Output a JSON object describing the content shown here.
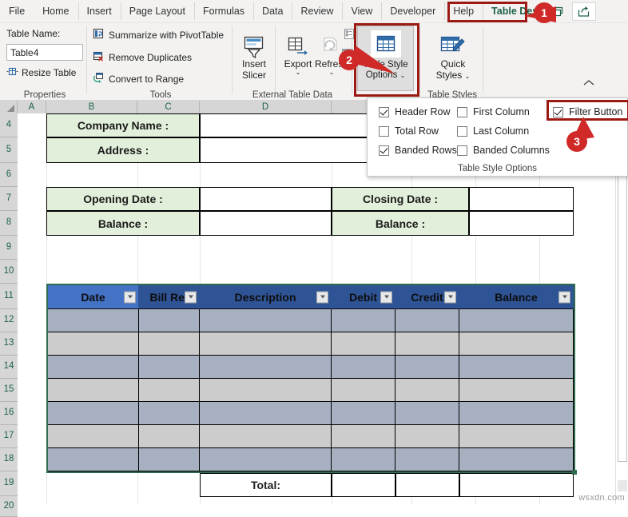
{
  "ribbon": {
    "tabs": [
      {
        "label": "File",
        "active": false
      },
      {
        "label": "Home",
        "active": false
      },
      {
        "label": "Insert",
        "active": false
      },
      {
        "label": "Page Layout",
        "active": false
      },
      {
        "label": "Formulas",
        "active": false
      },
      {
        "label": "Data",
        "active": false
      },
      {
        "label": "Review",
        "active": false
      },
      {
        "label": "View",
        "active": false
      },
      {
        "label": "Developer",
        "active": false
      },
      {
        "label": "Help",
        "active": false
      },
      {
        "label": "Table Design",
        "active": true
      }
    ],
    "share_icon": "share-icon",
    "restore_icon": "restore-window-icon",
    "collapse_icon": "chevron-up-icon",
    "groups": {
      "properties": {
        "title": "Properties",
        "table_name_label": "Table Name:",
        "table_name_value": "Table4",
        "resize_table": "Resize Table"
      },
      "tools": {
        "title": "Tools",
        "items": [
          "Summarize with PivotTable",
          "Remove Duplicates",
          "Convert to Range"
        ]
      },
      "external_table_data": {
        "title": "External Table Data",
        "insert_slicer": "Insert\nSlicer",
        "insert_slicer_line1": "Insert",
        "insert_slicer_line2": "Slicer",
        "export": "Export",
        "refresh": "Refresh"
      },
      "table_style_options": {
        "button_line1": "Table Style",
        "button_line2": "Options",
        "title": ""
      },
      "table_styles": {
        "title": "Table Styles",
        "quick_styles_line1": "Quick",
        "quick_styles_line2": "Styles"
      }
    }
  },
  "tso_panel": {
    "footer": "Table Style Options",
    "options": [
      {
        "label": "Header Row",
        "checked": true,
        "col": 0,
        "row": 0
      },
      {
        "label": "Total Row",
        "checked": false,
        "col": 0,
        "row": 1
      },
      {
        "label": "Banded Rows",
        "checked": true,
        "col": 0,
        "row": 2
      },
      {
        "label": "First Column",
        "checked": false,
        "col": 1,
        "row": 0
      },
      {
        "label": "Last Column",
        "checked": false,
        "col": 1,
        "row": 1
      },
      {
        "label": "Banded Columns",
        "checked": false,
        "col": 1,
        "row": 2
      },
      {
        "label": "Filter Button",
        "checked": true,
        "col": 2,
        "row": 0
      }
    ]
  },
  "callouts": [
    {
      "number": "1"
    },
    {
      "number": "2"
    },
    {
      "number": "3"
    }
  ],
  "sheet": {
    "column_headers": [
      "A",
      "B",
      "C",
      "D"
    ],
    "row_headers": [
      "4",
      "5",
      "6",
      "7",
      "8",
      "9",
      "10",
      "11",
      "12",
      "13",
      "14",
      "15",
      "16",
      "17",
      "18",
      "19",
      "20"
    ],
    "info_block_1": [
      {
        "label": "Company Name :",
        "value": ""
      },
      {
        "label": "Address :",
        "value": ""
      }
    ],
    "info_block_2": [
      {
        "label": "Opening Date :",
        "value": "",
        "label2": "Closing Date :",
        "value2": ""
      },
      {
        "label": "Balance :",
        "value": "",
        "label2": "Balance :",
        "value2": ""
      }
    ],
    "table": {
      "headers": [
        "Date",
        "Bill Ref",
        "Description",
        "Debit",
        "Credit",
        "Balance"
      ],
      "rows": [
        [
          "",
          "",
          "",
          "",
          "",
          ""
        ],
        [
          "",
          "",
          "",
          "",
          "",
          ""
        ],
        [
          "",
          "",
          "",
          "",
          "",
          ""
        ],
        [
          "",
          "",
          "",
          "",
          "",
          ""
        ],
        [
          "",
          "",
          "",
          "",
          "",
          ""
        ],
        [
          "",
          "",
          "",
          "",
          "",
          ""
        ],
        [
          "",
          "",
          "",
          "",
          "",
          ""
        ]
      ],
      "total_label": "Total:"
    }
  },
  "watermark": "wsxdn.com",
  "colors": {
    "accent_green": "#1d6245",
    "callout_red": "#cf2a27",
    "highlight_red": "#9c1a14",
    "table_header_blue": "#2f5496",
    "table_header_first": "#4472c4",
    "band_a": "#a7b0c0",
    "band_b": "#cccccc",
    "label_green_fill": "#e2efda",
    "ribbon_bg": "#f3f2f1"
  }
}
